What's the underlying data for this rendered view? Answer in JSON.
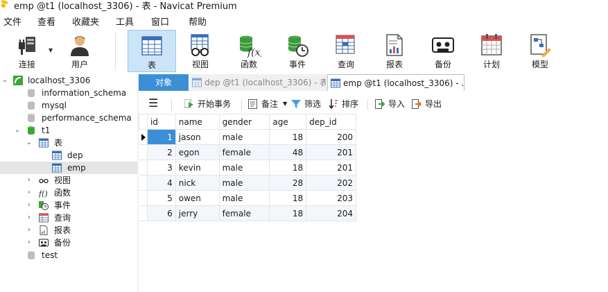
{
  "window": {
    "title": "emp @t1 (localhost_3306) - 表 - Navicat Premium"
  },
  "menu": [
    "文件",
    "查看",
    "收藏夹",
    "工具",
    "窗口",
    "帮助"
  ],
  "toolbar": {
    "connect": "连接",
    "user": "用户",
    "table": "表",
    "view": "视图",
    "function": "函数",
    "event": "事件",
    "query": "查询",
    "report": "报表",
    "backup": "备份",
    "schedule": "计划",
    "model": "模型"
  },
  "tree": {
    "connection": "localhost_3306",
    "databases": [
      "information_schema",
      "mysql",
      "performance_schema",
      "t1",
      "test"
    ],
    "t1_children": {
      "tables": "表",
      "tables_items": [
        "dep",
        "emp"
      ],
      "views": "视图",
      "functions": "函数",
      "events": "事件",
      "queries": "查询",
      "reports": "报表",
      "backups": "备份"
    }
  },
  "tabs": {
    "objects": "对象",
    "tab1": "dep @t1 (localhost_3306) - 表",
    "tab2": "emp @t1 (localhost_3306) - ..."
  },
  "objbar": {
    "begin_tx": "开始事务",
    "note": "备注",
    "filter": "筛选",
    "sort": "排序",
    "import": "导入",
    "export": "导出"
  },
  "grid": {
    "columns": [
      "id",
      "name",
      "gender",
      "age",
      "dep_id"
    ],
    "rows": [
      [
        "1",
        "jason",
        "male",
        "18",
        "200"
      ],
      [
        "2",
        "egon",
        "female",
        "48",
        "201"
      ],
      [
        "3",
        "kevin",
        "male",
        "18",
        "201"
      ],
      [
        "4",
        "nick",
        "male",
        "28",
        "202"
      ],
      [
        "5",
        "owen",
        "male",
        "18",
        "203"
      ],
      [
        "6",
        "jerry",
        "female",
        "18",
        "204"
      ]
    ]
  },
  "colors": {
    "accent": "#3c8fd7",
    "toolbar_active": "#cce4f7",
    "db_green": "#3ca637",
    "alt_row": "#f3f7fc"
  }
}
